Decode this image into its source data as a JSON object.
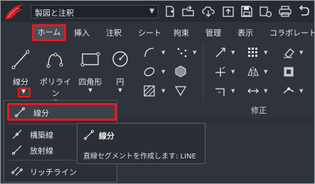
{
  "workspace": {
    "selected": "製図と注釈"
  },
  "tabs": [
    {
      "label": "ホーム",
      "active": true
    },
    {
      "label": "挿入"
    },
    {
      "label": "注釈"
    },
    {
      "label": "シート"
    },
    {
      "label": "拘束"
    },
    {
      "label": "管理"
    },
    {
      "label": "表示"
    },
    {
      "label": "コラボレート"
    }
  ],
  "ribbon": {
    "draw_buttons": [
      {
        "label": "線分",
        "icon": "line-icon"
      },
      {
        "label": "ポリライン",
        "icon": "polyline-icon"
      },
      {
        "label": "四角形",
        "icon": "rectangle-icon"
      },
      {
        "label": "円",
        "icon": "circle-icon"
      }
    ],
    "modify_panel_label": "修正"
  },
  "line_menu": {
    "items": [
      {
        "label": "線分",
        "icon": "line-icon",
        "highlighted": true
      },
      {
        "label": "構築線",
        "icon": "construction-line-icon"
      },
      {
        "label": "放射線",
        "icon": "ray-icon"
      },
      {
        "label": "リッチライン",
        "icon": "richline-icon"
      }
    ]
  },
  "tooltip": {
    "title": "線分",
    "description": "直線セグメントを作成します: LINE"
  },
  "colors": {
    "accent_red": "#e8181f",
    "background": "#2f333c"
  }
}
